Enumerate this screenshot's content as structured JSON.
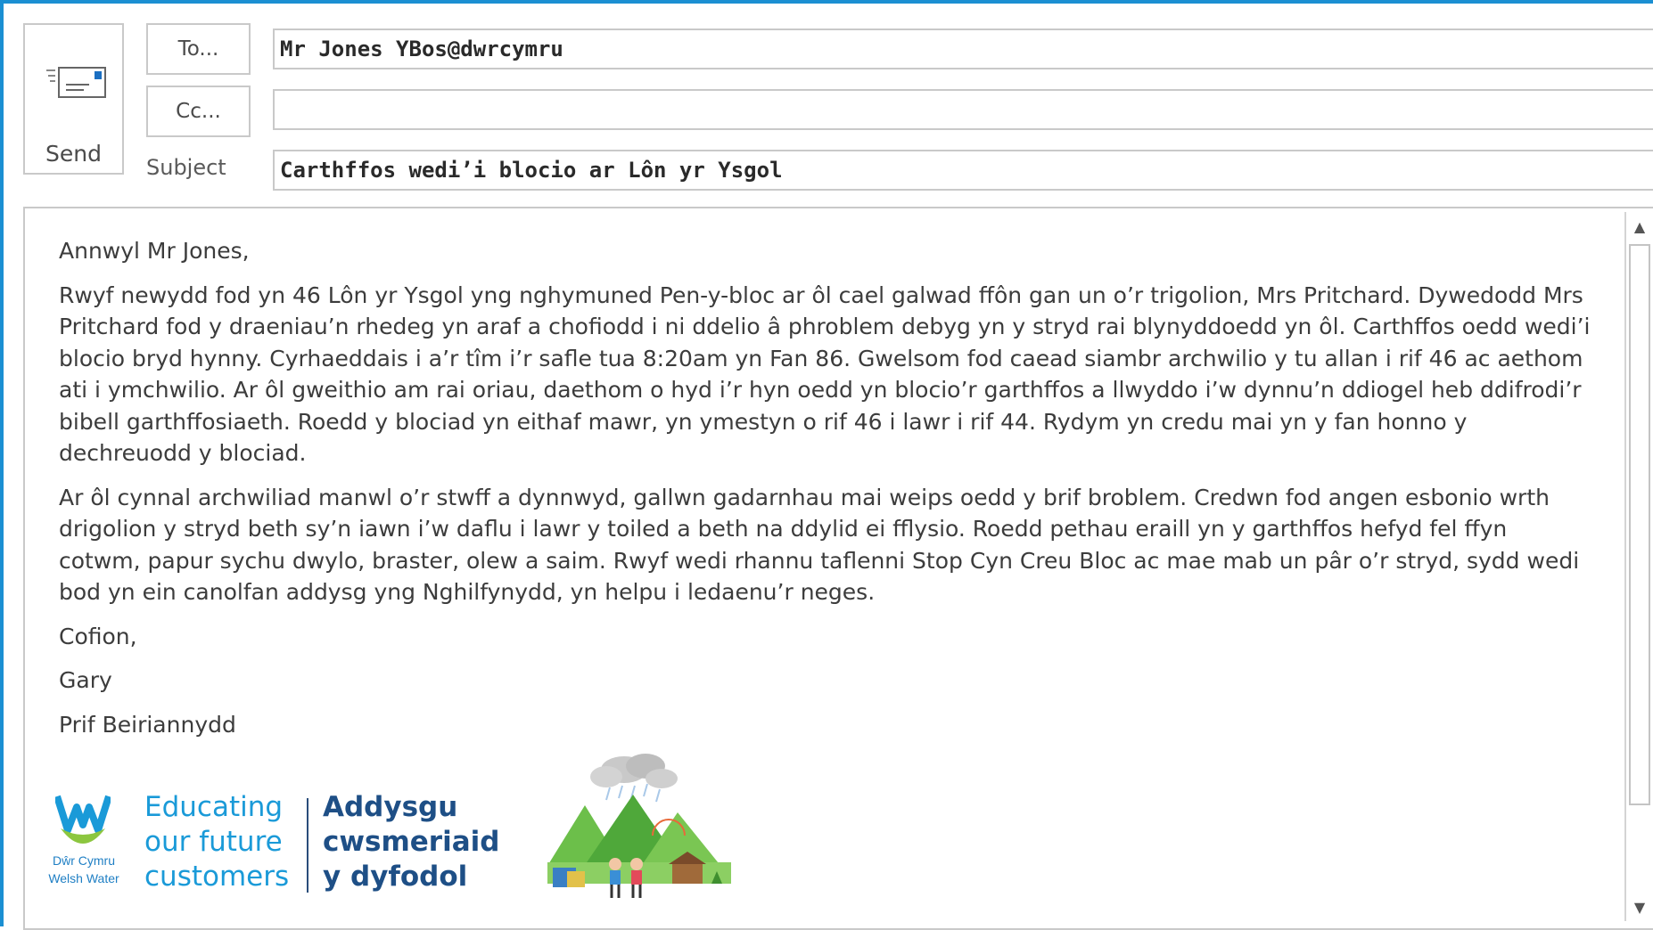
{
  "compose": {
    "send_label": "Send",
    "to_label": "To...",
    "cc_label": "Cc...",
    "subject_label": "Subject",
    "to_value": "Mr Jones YBos@dwrcymru",
    "cc_value": "",
    "subject_value": "Carthffos wedi’i blocio ar Lôn yr Ysgol"
  },
  "message": {
    "greeting": "Annwyl Mr Jones,",
    "paragraph1": "Rwyf newydd fod yn 46 Lôn yr Ysgol yng nghymuned Pen-y-bloc ar ôl cael galwad ffôn gan un o’r trigolion, Mrs Pritchard. Dywedodd Mrs Pritchard fod y draeniau’n rhedeg yn araf a chofiodd i ni ddelio â phroblem debyg yn y stryd rai blynyddoedd yn ôl. Carthffos oedd wedi’i blocio bryd hynny. Cyrhaeddais i a’r tîm i’r safle tua 8:20am yn Fan 86. Gwelsom fod caead siambr archwilio y tu allan i rif 46 ac aethom ati i ymchwilio. Ar ôl gweithio am rai oriau, daethom o hyd i’r hyn oedd yn blocio’r garthffos a llwyddo i’w dynnu’n ddiogel heb ddifrodi’r bibell garthffosiaeth. Roedd y blociad yn eithaf mawr, yn ymestyn o rif 46 i lawr i rif 44. Rydym yn credu mai yn y fan honno y dechreuodd y blociad.",
    "paragraph2": "Ar ôl cynnal archwiliad manwl o’r stwff a dynnwyd, gallwn gadarnhau mai weips oedd y brif broblem. Credwn fod angen esbonio wrth drigolion y stryd beth sy’n iawn i’w daflu i lawr y toiled a beth na ddylid ei fflysio. Roedd pethau eraill yn y garthffos hefyd fel ffyn cotwm, papur sychu dwylo, braster, olew a saim. Rwyf wedi rhannu taflenni Stop Cyn Creu Bloc ac mae mab un pâr o’r stryd, sydd wedi bod yn ein canolfan addysg yng Nghilfynydd, yn helpu i ledaenu’r neges.",
    "signoff": "Cofion,",
    "name": "Gary",
    "role": "Prif Beiriannydd"
  },
  "signature": {
    "brand_line1": "Dŵr Cymru",
    "brand_line2": "Welsh Water",
    "english_line1": "Educating",
    "english_line2": "our future",
    "english_line3": "customers",
    "welsh_line1": "Addysgu",
    "welsh_line2": "cwsmeriaid",
    "welsh_line3": "y dyfodol"
  },
  "colors": {
    "window_border": "#1b8fd2",
    "brand_light_blue": "#1a9ad8",
    "brand_dark_blue": "#1e4f86",
    "logo_green": "#8cc63f"
  },
  "icons": {
    "send": "envelope-send-icon",
    "scroll_up": "arrow-up-icon",
    "scroll_down": "arrow-down-icon"
  }
}
